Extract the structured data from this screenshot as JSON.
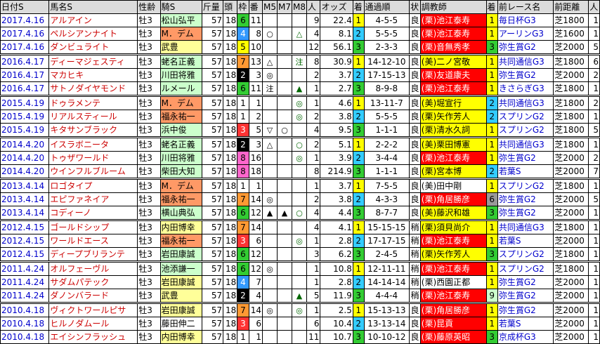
{
  "headers": [
    "日付S",
    "馬名S",
    "性齢",
    "騎S",
    "斤量",
    "頭",
    "枠",
    "番",
    "M5",
    "M7",
    "M8",
    "人",
    "オッズ",
    "着",
    "通過順",
    "状",
    "調教師",
    "着",
    "前レース名",
    "前距離",
    "人"
  ],
  "colors": {
    "gate": {
      "1": "#ffffff",
      "2": "#000000",
      "3": "#ff3333",
      "4": "#3399ff",
      "5": "#ffff00",
      "6": "#33cc33",
      "7": "#ff9933",
      "8": "#ff66cc"
    },
    "pop": {
      "1": "#ffff00",
      "2": "#33ccff",
      "3": "#33cc33",
      "4": "#ff9933",
      "5": "#ff66cc",
      "6": "#999999",
      "7": "#cc99ff",
      "8": "#66cccc",
      "9": "#ccffcc",
      "10": "#ffcccc"
    },
    "trainer_west": "#ff0000",
    "trainer_east": "#ffff00",
    "trainer_default": "#ffffff"
  },
  "rows": [
    {
      "date": "2017.4.16",
      "horse": "アルアイン",
      "sex": "牡3",
      "jockey": "松山弘平",
      "jc": "green",
      "kin": "57",
      "n": "18",
      "waku": "6",
      "ban": "11",
      "m5": "",
      "m7": "",
      "m8": "",
      "pop": "9",
      "odds": "22.4",
      "rank": "1",
      "tsuka": "4-5-5",
      "jo": "良",
      "tr": "(栗)池江泰寿",
      "tc": "west",
      "prank": "1",
      "prace": "毎日杯G3",
      "pdist": "芝1800",
      "pp": "1",
      "sep": false
    },
    {
      "date": "2017.4.16",
      "horse": "ペルシアンナイト",
      "sex": "牡3",
      "jockey": "M．デム",
      "jc": "orange",
      "kin": "57",
      "n": "18",
      "waku": "4",
      "ban": "8",
      "m5": "○",
      "m7": "",
      "m8": "△",
      "pop": "4",
      "odds": "8.1",
      "rank": "2",
      "tsuka": "5-5-5",
      "jo": "良",
      "tr": "(栗)池江泰寿",
      "tc": "west",
      "prank": "1",
      "prace": "アーリンG3",
      "pdist": "芝1600",
      "pp": "1",
      "sep": false
    },
    {
      "date": "2017.4.16",
      "horse": "ダンビュライト",
      "sex": "牡3",
      "jockey": "武豊",
      "jc": "yellow",
      "kin": "57",
      "n": "18",
      "waku": "5",
      "ban": "10",
      "m5": "",
      "m7": "",
      "m8": "",
      "pop": "12",
      "odds": "56.1",
      "rank": "3",
      "tsuka": "2-3-3",
      "jo": "良",
      "tr": "(栗)音無秀孝",
      "tc": "west",
      "prank": "3",
      "prace": "弥生賞G2",
      "pdist": "芝2000",
      "pp": "5",
      "sep": true
    },
    {
      "date": "2016.4.17",
      "horse": "ディーマジェスティ",
      "sex": "牡3",
      "jockey": "蛯名正義",
      "jc": "green",
      "kin": "57",
      "n": "18",
      "waku": "7",
      "ban": "13",
      "m5": "△",
      "m7": "",
      "m8": "注",
      "pop": "8",
      "odds": "30.9",
      "rank": "1",
      "tsuka": "14-12-10",
      "jo": "良",
      "tr": "(美)二ノ宮敬",
      "tc": "east",
      "prank": "1",
      "prace": "共同通信G3",
      "pdist": "芝1800",
      "pp": "6",
      "sep": false
    },
    {
      "date": "2016.4.17",
      "horse": "マカヒキ",
      "sex": "牡3",
      "jockey": "川田将雅",
      "jc": "green",
      "kin": "57",
      "n": "18",
      "waku": "2",
      "ban": "3",
      "m5": "◎",
      "m7": "",
      "m8": "",
      "pop": "2",
      "odds": "3.7",
      "rank": "2",
      "tsuka": "17-15-13",
      "jo": "良",
      "tr": "(栗)友道康夫",
      "tc": "west",
      "prank": "1",
      "prace": "弥生賞G2",
      "pdist": "芝2000",
      "pp": "2",
      "sep": false
    },
    {
      "date": "2016.4.17",
      "horse": "サトノダイヤモンド",
      "sex": "牡3",
      "jockey": "ルメール",
      "jc": "green",
      "kin": "57",
      "n": "18",
      "waku": "6",
      "ban": "11",
      "m5": "注",
      "m7": "",
      "m8": "▲",
      "pop": "1",
      "odds": "2.7",
      "rank": "3",
      "tsuka": "8-9-8",
      "jo": "良",
      "tr": "(栗)池江泰寿",
      "tc": "west",
      "prank": "1",
      "prace": "きさらぎG3",
      "pdist": "芝1800",
      "pp": "1",
      "sep": true
    },
    {
      "date": "2015.4.19",
      "horse": "ドゥラメンテ",
      "sex": "牡3",
      "jockey": "M．デム",
      "jc": "orange",
      "kin": "57",
      "n": "18",
      "waku": "1",
      "ban": "1",
      "m5": "",
      "m7": "",
      "m8": "◎",
      "pop": "1",
      "odds": "4.6",
      "rank": "1",
      "tsuka": "13-11-7",
      "jo": "良",
      "tr": "(美)堀宣行",
      "tc": "east",
      "prank": "2",
      "prace": "共同通信G3",
      "pdist": "芝1800",
      "pp": "2",
      "sep": false
    },
    {
      "date": "2015.4.19",
      "horse": "リアルスティール",
      "sex": "牡3",
      "jockey": "福永祐一",
      "jc": "orange",
      "kin": "57",
      "n": "18",
      "waku": "1",
      "ban": "2",
      "m5": "",
      "m7": "",
      "m8": "◎",
      "pop": "2",
      "odds": "3.8",
      "rank": "2",
      "tsuka": "5-5-5",
      "jo": "良",
      "tr": "(栗)矢作芳人",
      "tc": "east",
      "prank": "2",
      "prace": "スプリンG2",
      "pdist": "芝1800",
      "pp": "1",
      "sep": false
    },
    {
      "date": "2015.4.19",
      "horse": "キタサンブラック",
      "sex": "牡3",
      "jockey": "浜中俊",
      "jc": "green",
      "kin": "57",
      "n": "18",
      "waku": "3",
      "ban": "5",
      "m5": "▽",
      "m7": "○",
      "m8": "",
      "pop": "4",
      "odds": "9.5",
      "rank": "3",
      "tsuka": "1-1-1",
      "jo": "良",
      "tr": "(栗)清水久詞",
      "tc": "east",
      "prank": "1",
      "prace": "スプリンG2",
      "pdist": "芝1800",
      "pp": "5",
      "sep": true
    },
    {
      "date": "2014.4.20",
      "horse": "イスラボニータ",
      "sex": "牡3",
      "jockey": "蛯名正義",
      "jc": "green",
      "kin": "57",
      "n": "18",
      "waku": "2",
      "ban": "3",
      "m5": "△",
      "m7": "",
      "m8": "○",
      "pop": "2",
      "odds": "5.1",
      "rank": "1",
      "tsuka": "2-2-2",
      "jo": "良",
      "tr": "(美)栗田博憲",
      "tc": "east",
      "prank": "1",
      "prace": "共同通信G3",
      "pdist": "芝1800",
      "pp": "1",
      "sep": false
    },
    {
      "date": "2014.4.20",
      "horse": "トゥザワールド",
      "sex": "牡3",
      "jockey": "川田将雅",
      "jc": "green",
      "kin": "57",
      "n": "18",
      "waku": "8",
      "ban": "16",
      "m5": "",
      "m7": "",
      "m8": "◎",
      "pop": "1",
      "odds": "3.9",
      "rank": "2",
      "tsuka": "3-4-4",
      "jo": "良",
      "tr": "(栗)池江泰寿",
      "tc": "west",
      "prank": "1",
      "prace": "弥生賞G2",
      "pdist": "芝2000",
      "pp": "2",
      "sep": false
    },
    {
      "date": "2014.4.20",
      "horse": "ウインフルブルーム",
      "sex": "牡3",
      "jockey": "柴田大知",
      "jc": "green",
      "kin": "57",
      "n": "18",
      "waku": "8",
      "ban": "18",
      "m5": "",
      "m7": "",
      "m8": "",
      "pop": "8",
      "odds": "214.9",
      "rank": "3",
      "tsuka": "1-1-1",
      "jo": "良",
      "tr": "(栗)宮本博",
      "tc": "east",
      "prank": "2",
      "prace": "若葉S",
      "pdist": "芝2000",
      "pp": "7",
      "sep": true
    },
    {
      "date": "2013.4.14",
      "horse": "ロゴタイプ",
      "sex": "牡3",
      "jockey": "M．デム",
      "jc": "orange",
      "kin": "57",
      "n": "18",
      "waku": "1",
      "ban": "1",
      "m5": "",
      "m7": "",
      "m8": "",
      "pop": "1",
      "odds": "3.7",
      "rank": "1",
      "tsuka": "7-5-5",
      "jo": "良",
      "tr": "(美)田中剛",
      "tc": "default",
      "prank": "1",
      "prace": "スプリンG2",
      "pdist": "芝1800",
      "pp": "1",
      "sep": false
    },
    {
      "date": "2013.4.14",
      "horse": "エピファネイア",
      "sex": "牡3",
      "jockey": "福永祐一",
      "jc": "orange",
      "kin": "57",
      "n": "18",
      "waku": "7",
      "ban": "14",
      "m5": "◎",
      "m7": "",
      "m8": "",
      "pop": "2",
      "odds": "3.8",
      "rank": "2",
      "tsuka": "4-3-3",
      "jo": "良",
      "tr": "(栗)角居勝彦",
      "tc": "west",
      "prank": "6",
      "prace": "弥生賞G2",
      "pdist": "芝2000",
      "pp": "5",
      "sep": false
    },
    {
      "date": "2013.4.14",
      "horse": "コディーノ",
      "sex": "牡3",
      "jockey": "横山典弘",
      "jc": "green",
      "kin": "57",
      "n": "18",
      "waku": "6",
      "ban": "12",
      "m5": "▲",
      "m7": "▲",
      "m8": "○",
      "pop": "4",
      "odds": "4.4",
      "rank": "3",
      "tsuka": "8-7-7",
      "jo": "良",
      "tr": "(美)藤沢和雄",
      "tc": "east",
      "prank": "3",
      "prace": "弥生賞G2",
      "pdist": "芝2000",
      "pp": "1",
      "sep": true
    },
    {
      "date": "2012.4.15",
      "horse": "ゴールドシップ",
      "sex": "牡3",
      "jockey": "内田博幸",
      "jc": "yellow",
      "kin": "57",
      "n": "18",
      "waku": "7",
      "ban": "14",
      "m5": "",
      "m7": "",
      "m8": "",
      "pop": "4",
      "odds": "4.1",
      "rank": "1",
      "tsuka": "15-15-15",
      "jo": "稍",
      "tr": "(栗)須貝尚介",
      "tc": "east",
      "prank": "1",
      "prace": "共同通信G3",
      "pdist": "芝1800",
      "pp": "1",
      "sep": false
    },
    {
      "date": "2012.4.15",
      "horse": "ワールドエース",
      "sex": "牡3",
      "jockey": "福永祐一",
      "jc": "orange",
      "kin": "57",
      "n": "18",
      "waku": "3",
      "ban": "6",
      "m5": "",
      "m7": "",
      "m8": "◎",
      "pop": "1",
      "odds": "2.8",
      "rank": "2",
      "tsuka": "17-17-15",
      "jo": "稍",
      "tr": "(栗)池江泰寿",
      "tc": "west",
      "prank": "1",
      "prace": "若葉S",
      "pdist": "芝2000",
      "pp": "1",
      "sep": false
    },
    {
      "date": "2012.4.15",
      "horse": "ディープブリランテ",
      "sex": "牡3",
      "jockey": "岩田康誠",
      "jc": "green",
      "kin": "57",
      "n": "18",
      "waku": "6",
      "ban": "12",
      "m5": "",
      "m7": "",
      "m8": "",
      "pop": "3",
      "odds": "6.2",
      "rank": "3",
      "tsuka": "2-4-5",
      "jo": "稍",
      "tr": "(栗)矢作芳人",
      "tc": "east",
      "prank": "3",
      "prace": "スプリンG2",
      "pdist": "芝1800",
      "pp": "1",
      "sep": true
    },
    {
      "date": "2011.4.24",
      "horse": "オルフェーヴル",
      "sex": "牡3",
      "jockey": "池添謙一",
      "jc": "green",
      "kin": "57",
      "n": "18",
      "waku": "6",
      "ban": "12",
      "m5": "◎",
      "m7": "",
      "m8": "",
      "pop": "1",
      "odds": "10.8",
      "rank": "1",
      "tsuka": "12-11-11",
      "jo": "稍",
      "tr": "(栗)池江泰寿",
      "tc": "west",
      "prank": "1",
      "prace": "スプリンG2",
      "pdist": "芝1800",
      "pp": "1",
      "sep": false
    },
    {
      "date": "2011.4.24",
      "horse": "サダムパテック",
      "sex": "牡3",
      "jockey": "岩田康誠",
      "jc": "yellow",
      "kin": "57",
      "n": "18",
      "waku": "4",
      "ban": "7",
      "m5": "",
      "m7": "",
      "m8": "",
      "pop": "1",
      "odds": "2.8",
      "rank": "2",
      "tsuka": "14-14-14",
      "jo": "稍",
      "tr": "(栗)西園正都",
      "tc": "default",
      "prank": "1",
      "prace": "弥生賞G2",
      "pdist": "芝2000",
      "pp": "1",
      "sep": false
    },
    {
      "date": "2011.4.24",
      "horse": "ダノンバラード",
      "sex": "牡3",
      "jockey": "武豊",
      "jc": "yellow",
      "kin": "57",
      "n": "18",
      "waku": "2",
      "ban": "4",
      "m5": "",
      "m7": "",
      "m8": "▲",
      "pop": "5",
      "odds": "11.9",
      "rank": "3",
      "tsuka": "4-4-4",
      "jo": "稍",
      "tr": "(栗)池江泰寿",
      "tc": "west",
      "prank": "9",
      "prace": "弥生賞G2",
      "pdist": "芝2000",
      "pp": "1",
      "sep": true
    },
    {
      "date": "2010.4.18",
      "horse": "ヴィクトワールピサ",
      "sex": "牡3",
      "jockey": "岩田康誠",
      "jc": "yellow",
      "kin": "57",
      "n": "18",
      "waku": "7",
      "ban": "14",
      "m5": "◎",
      "m7": "",
      "m8": "◎",
      "pop": "1",
      "odds": "2.5",
      "rank": "1",
      "tsuka": "15-13-13",
      "jo": "良",
      "tr": "(栗)角居勝彦",
      "tc": "west",
      "prank": "1",
      "prace": "弥生賞G2",
      "pdist": "芝2000",
      "pp": "1",
      "sep": false
    },
    {
      "date": "2010.4.18",
      "horse": "ヒルノダムール",
      "sex": "牡3",
      "jockey": "藤田伸二",
      "jc": "default",
      "kin": "57",
      "n": "18",
      "waku": "3",
      "ban": "6",
      "m5": "",
      "m7": "",
      "m8": "",
      "pop": "6",
      "odds": "10.4",
      "rank": "2",
      "tsuka": "13-13-14",
      "jo": "良",
      "tr": "(栗)昆貢",
      "tc": "west",
      "prank": "1",
      "prace": "若葉S",
      "pdist": "芝2000",
      "pp": "1",
      "sep": false
    },
    {
      "date": "2010.4.18",
      "horse": "エイシンフラッシュ",
      "sex": "牡3",
      "jockey": "内田博幸",
      "jc": "yellow",
      "kin": "57",
      "n": "18",
      "waku": "1",
      "ban": "1",
      "m5": "",
      "m7": "",
      "m8": "",
      "pop": "11",
      "odds": "10.7",
      "rank": "3",
      "tsuka": "10-10-12",
      "jo": "良",
      "tr": "(栗)藤原英昭",
      "tc": "west",
      "prank": "3",
      "prace": "京成杯G3",
      "pdist": "芝2000",
      "pp": "1",
      "sep": false
    }
  ]
}
